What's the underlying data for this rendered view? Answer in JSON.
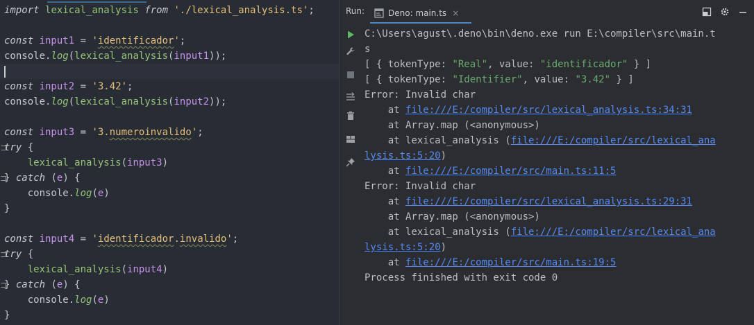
{
  "editor": {
    "lines": [
      [
        {
          "t": "import ",
          "c": "kw"
        },
        {
          "t": "lexical_analysis",
          "c": "fn"
        },
        {
          "t": " ",
          "c": "txt"
        },
        {
          "t": "from",
          "c": "kw"
        },
        {
          "t": " ",
          "c": "txt"
        },
        {
          "t": "'./lexical_analysis.ts'",
          "c": "str"
        },
        {
          "t": ";",
          "c": "txt"
        }
      ],
      [],
      [
        {
          "t": "const ",
          "c": "kw"
        },
        {
          "t": "input1",
          "c": "var"
        },
        {
          "t": " = ",
          "c": "txt"
        },
        {
          "t": "'",
          "c": "str"
        },
        {
          "t": "identificador",
          "c": "str squig"
        },
        {
          "t": "'",
          "c": "str"
        },
        {
          "t": ";",
          "c": "txt"
        }
      ],
      [
        {
          "t": "console.",
          "c": "txt"
        },
        {
          "t": "log",
          "c": "mth"
        },
        {
          "t": "(",
          "c": "txt"
        },
        {
          "t": "lexical_analysis",
          "c": "fn"
        },
        {
          "t": "(",
          "c": "txt"
        },
        {
          "t": "input1",
          "c": "var"
        },
        {
          "t": "));",
          "c": "txt"
        }
      ],
      [],
      [
        {
          "t": "const ",
          "c": "kw"
        },
        {
          "t": "input2",
          "c": "var"
        },
        {
          "t": " = ",
          "c": "txt"
        },
        {
          "t": "'3.42'",
          "c": "str"
        },
        {
          "t": ";",
          "c": "txt"
        }
      ],
      [
        {
          "t": "console.",
          "c": "txt"
        },
        {
          "t": "log",
          "c": "mth"
        },
        {
          "t": "(",
          "c": "txt"
        },
        {
          "t": "lexical_analysis",
          "c": "fn"
        },
        {
          "t": "(",
          "c": "txt"
        },
        {
          "t": "input2",
          "c": "var"
        },
        {
          "t": "));",
          "c": "txt"
        }
      ],
      [],
      [
        {
          "t": "const ",
          "c": "kw"
        },
        {
          "t": "input3",
          "c": "var"
        },
        {
          "t": " = ",
          "c": "txt"
        },
        {
          "t": "'3.",
          "c": "str"
        },
        {
          "t": "numeroinvalido",
          "c": "str squig"
        },
        {
          "t": "'",
          "c": "str"
        },
        {
          "t": ";",
          "c": "txt"
        }
      ],
      [
        {
          "t": "try",
          "c": "kw"
        },
        {
          "t": " {",
          "c": "txt"
        }
      ],
      [
        {
          "t": "    ",
          "c": "txt"
        },
        {
          "t": "lexical_analysis",
          "c": "fn"
        },
        {
          "t": "(",
          "c": "txt"
        },
        {
          "t": "input3",
          "c": "var"
        },
        {
          "t": ")",
          "c": "txt"
        }
      ],
      [
        {
          "t": "} ",
          "c": "txt"
        },
        {
          "t": "catch",
          "c": "kw"
        },
        {
          "t": " (",
          "c": "txt"
        },
        {
          "t": "e",
          "c": "var"
        },
        {
          "t": ") {",
          "c": "txt"
        }
      ],
      [
        {
          "t": "    console.",
          "c": "txt"
        },
        {
          "t": "log",
          "c": "mth"
        },
        {
          "t": "(",
          "c": "txt"
        },
        {
          "t": "e",
          "c": "var"
        },
        {
          "t": ")",
          "c": "txt"
        }
      ],
      [
        {
          "t": "}",
          "c": "txt"
        }
      ],
      [],
      [
        {
          "t": "const ",
          "c": "kw"
        },
        {
          "t": "input4",
          "c": "var"
        },
        {
          "t": " = ",
          "c": "txt"
        },
        {
          "t": "'",
          "c": "str"
        },
        {
          "t": "identificador",
          "c": "str squig"
        },
        {
          "t": ".",
          "c": "str"
        },
        {
          "t": "invalido",
          "c": "str squig"
        },
        {
          "t": "'",
          "c": "str"
        },
        {
          "t": ";",
          "c": "txt"
        }
      ],
      [
        {
          "t": "try",
          "c": "kw"
        },
        {
          "t": " {",
          "c": "txt"
        }
      ],
      [
        {
          "t": "    ",
          "c": "txt"
        },
        {
          "t": "lexical_analysis",
          "c": "fn"
        },
        {
          "t": "(",
          "c": "txt"
        },
        {
          "t": "input4",
          "c": "var"
        },
        {
          "t": ")",
          "c": "txt"
        }
      ],
      [
        {
          "t": "} ",
          "c": "txt"
        },
        {
          "t": "catch",
          "c": "kw"
        },
        {
          "t": " (",
          "c": "txt"
        },
        {
          "t": "e",
          "c": "var"
        },
        {
          "t": ") {",
          "c": "txt"
        }
      ],
      [
        {
          "t": "    console.",
          "c": "txt"
        },
        {
          "t": "log",
          "c": "mth"
        },
        {
          "t": "(",
          "c": "txt"
        },
        {
          "t": "e",
          "c": "var"
        },
        {
          "t": ")",
          "c": "txt"
        }
      ],
      [
        {
          "t": "}",
          "c": "txt"
        }
      ]
    ]
  },
  "run_panel": {
    "label": "Run:",
    "tab_label": "Deno: main.ts",
    "tab_close": "×",
    "header_icons": [
      "restore-layout-icon",
      "gear-icon",
      "minimize-icon"
    ],
    "tools": [
      "run-icon",
      "wrench-icon",
      "stop-icon",
      "soft-wrap-icon",
      "trash-icon",
      "layout-icon",
      "pin-icon"
    ]
  },
  "console": {
    "lines": [
      [
        {
          "t": "C:\\Users\\agust\\.deno\\bin\\deno.exe run E:\\compiler\\src\\main.t"
        }
      ],
      [
        {
          "t": "s"
        }
      ],
      [
        {
          "t": "[ { tokenType: "
        },
        {
          "t": "\"Real\"",
          "c": "cstr"
        },
        {
          "t": ", value: "
        },
        {
          "t": "\"identificador\"",
          "c": "cstr"
        },
        {
          "t": " } ]"
        }
      ],
      [
        {
          "t": "[ { tokenType: "
        },
        {
          "t": "\"Identifier\"",
          "c": "cstr"
        },
        {
          "t": ", value: "
        },
        {
          "t": "\"3.42\"",
          "c": "cstr"
        },
        {
          "t": " } ]"
        }
      ],
      [
        {
          "t": "Error: Invalid char"
        }
      ],
      [
        {
          "t": "    at "
        },
        {
          "t": "file:///E:/compiler/src/lexical_analysis.ts:34:31",
          "c": "link"
        }
      ],
      [
        {
          "t": "    at Array.map (<anonymous>)"
        }
      ],
      [
        {
          "t": "    at lexical_analysis ("
        },
        {
          "t": "file:///E:/compiler/src/lexical_ana",
          "c": "link"
        }
      ],
      [
        {
          "t": "lysis.ts:5:20",
          "c": "link"
        },
        {
          "t": ")"
        }
      ],
      [
        {
          "t": "    at "
        },
        {
          "t": "file:///E:/compiler/src/main.ts:11:5",
          "c": "link"
        }
      ],
      [
        {
          "t": "Error: Invalid char"
        }
      ],
      [
        {
          "t": "    at "
        },
        {
          "t": "file:///E:/compiler/src/lexical_analysis.ts:29:31",
          "c": "link"
        }
      ],
      [
        {
          "t": "    at Array.map (<anonymous>)"
        }
      ],
      [
        {
          "t": "    at lexical_analysis ("
        },
        {
          "t": "file:///E:/compiler/src/lexical_ana",
          "c": "link"
        }
      ],
      [
        {
          "t": "lysis.ts:5:20",
          "c": "link"
        },
        {
          "t": ")"
        }
      ],
      [
        {
          "t": "    at "
        },
        {
          "t": "file:///E:/compiler/src/main.ts:19:5",
          "c": "link"
        }
      ],
      [
        {
          "t": "Process finished with exit code 0"
        }
      ]
    ]
  }
}
